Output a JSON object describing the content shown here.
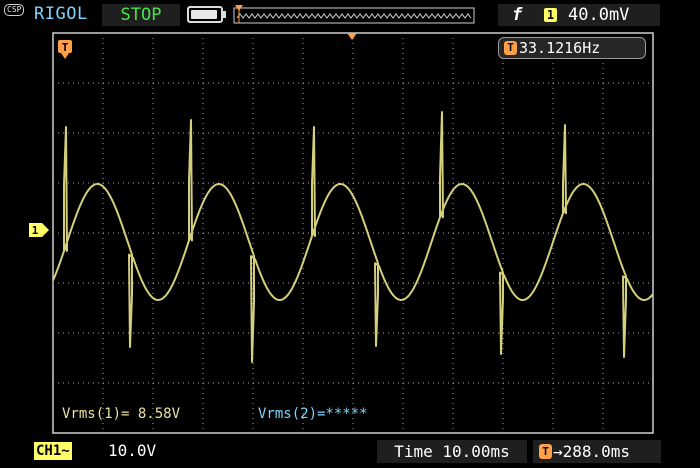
{
  "header": {
    "badge": "CSP",
    "brand": "RIGOL",
    "run_state": "STOP",
    "trigger": {
      "edge_icon": "rising-edge-icon",
      "channel": "1",
      "level": "40.0mV"
    }
  },
  "plot": {
    "frequency_label": "T",
    "frequency": "33.1216Hz",
    "trigger_position_marker": "T",
    "channel_marker": "1",
    "measurements": {
      "vrms1": "Vrms(1)= 8.58V",
      "vrms2": "Vrms(2)=*****"
    },
    "colors": {
      "channel1": "#d4cf7a",
      "grid": "#8a8a8a",
      "frame": "#cfcfcf",
      "accent_orange": "#ff9f4a",
      "accent_yellow": "#ffff66",
      "measure_cyan": "#7fd3ff"
    }
  },
  "footer": {
    "ch1_tag": "CH1~",
    "ch1_scale": "10.0V",
    "timebase": "Time 10.00ms",
    "offset_icon": "T",
    "offset_value": "→288.0ms"
  }
}
